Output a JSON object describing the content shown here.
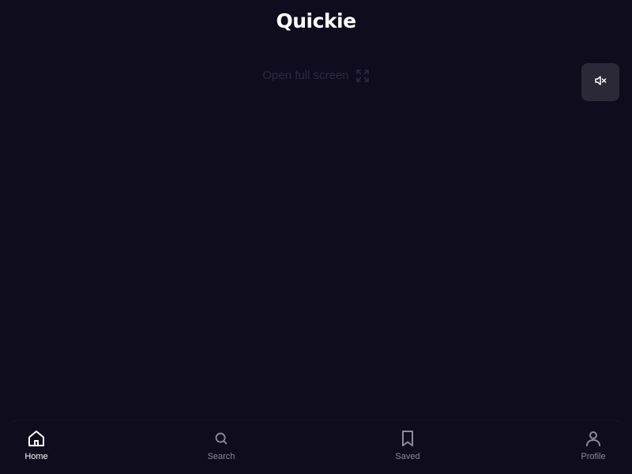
{
  "app": {
    "title": "Quickie"
  },
  "player": {
    "fullscreen_label": "Open full screen",
    "fullscreen_icon": "expand-icon",
    "mute_icon": "volume-mute-icon"
  },
  "nav": {
    "items": [
      {
        "label": "Home",
        "icon": "home-icon",
        "active": true
      },
      {
        "label": "Search",
        "icon": "search-icon",
        "active": false
      },
      {
        "label": "Saved",
        "icon": "bookmark-icon",
        "active": false
      },
      {
        "label": "Profile",
        "icon": "user-icon",
        "active": false
      }
    ]
  },
  "colors": {
    "background": "#0f0d1d",
    "active": "#ffffff",
    "inactive": "#8d8b98",
    "button_bg": "#2b2937",
    "muted_text": "#2c2a40"
  }
}
